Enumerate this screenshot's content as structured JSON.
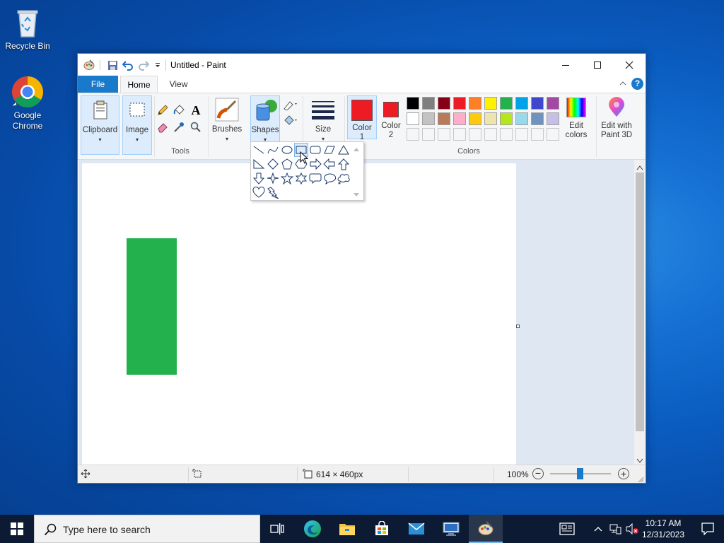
{
  "desktop": {
    "icons": [
      {
        "label": "Recycle Bin"
      },
      {
        "label": "Google Chrome"
      }
    ]
  },
  "window": {
    "title": "Untitled - Paint",
    "tabs": {
      "file": "File",
      "home": "Home",
      "view": "View"
    },
    "ribbon": {
      "clipboard": "Clipboard",
      "image": "Image",
      "tools_group": "Tools",
      "brushes": "Brushes",
      "shapes": "Shapes",
      "size": "Size",
      "color1": "Color 1",
      "color2": "Color 2",
      "colors_group": "Colors",
      "edit_colors": "Edit colors",
      "edit_paint3d": "Edit with Paint 3D"
    },
    "colors": {
      "color1": "#ed1c24",
      "color2": "#ed1c24",
      "palette_row1": [
        "#000000",
        "#7f7f7f",
        "#880015",
        "#ed1c24",
        "#ff7f27",
        "#fff200",
        "#22b14c",
        "#00a2e8",
        "#3f48cc",
        "#a349a4"
      ],
      "palette_row2": [
        "#ffffff",
        "#c3c3c3",
        "#b97a57",
        "#ffaec9",
        "#ffc90e",
        "#efe4b0",
        "#b5e61d",
        "#99d9ea",
        "#7092be",
        "#c8bfe7"
      ],
      "canvas_shape": "#22b14c"
    },
    "shapes_menu": {
      "hovered": "rectangle",
      "items": [
        "line",
        "curve",
        "oval",
        "rectangle",
        "rounded-rectangle",
        "polygon",
        "triangle",
        "right-triangle",
        "diamond",
        "pentagon",
        "hexagon",
        "right-arrow",
        "left-arrow",
        "up-arrow",
        "down-arrow",
        "four-point-star",
        "five-point-star",
        "six-point-star",
        "rounded-rectangular-callout",
        "oval-callout",
        "cloud-callout",
        "heart",
        "lightning"
      ]
    },
    "status": {
      "size": "614 × 460px",
      "zoom": "100%"
    }
  },
  "taskbar": {
    "search_placeholder": "Type here to search",
    "time": "10:17 AM",
    "date": "12/31/2023"
  }
}
